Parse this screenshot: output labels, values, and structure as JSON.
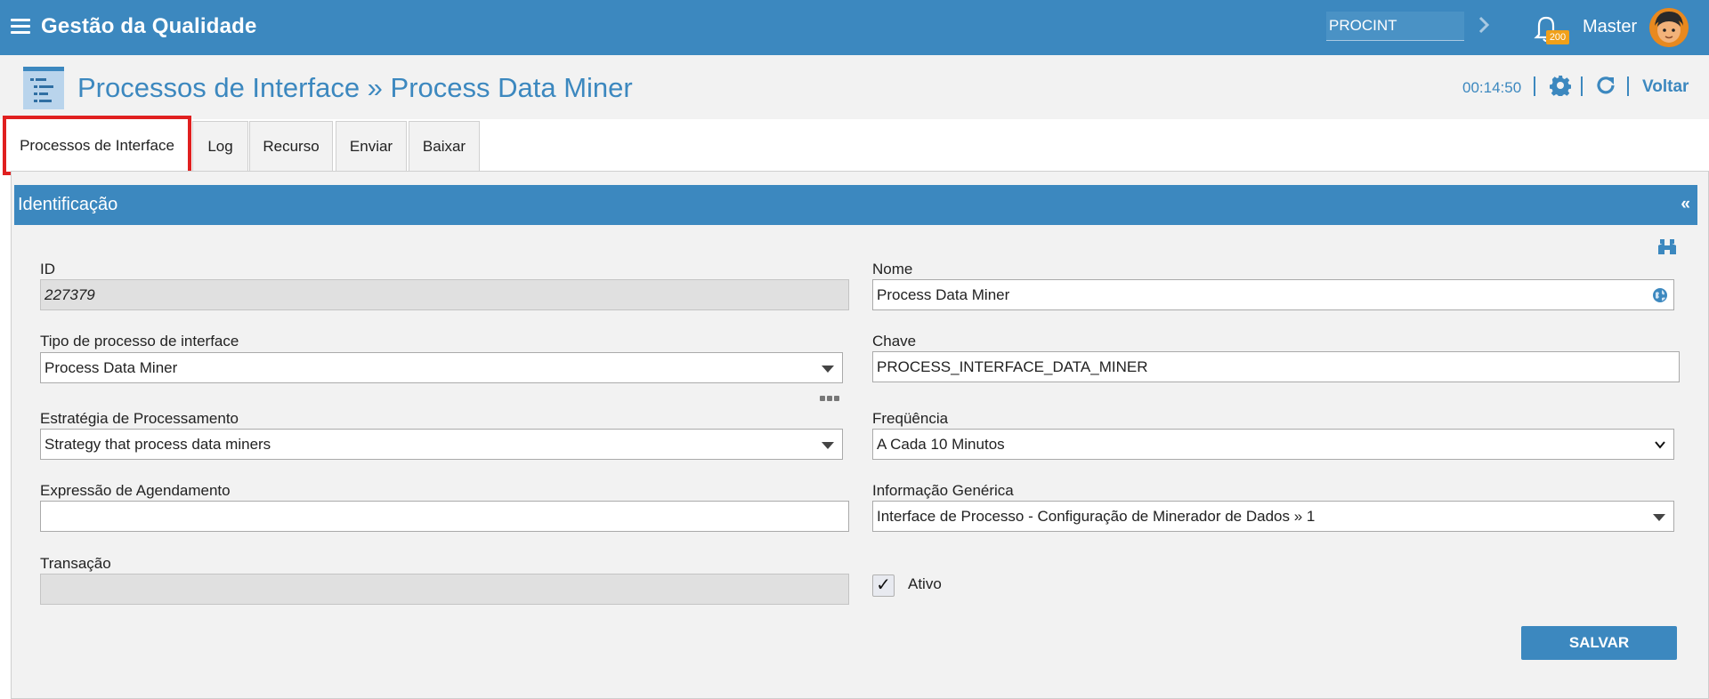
{
  "app": {
    "title": "Gestão da Qualidade"
  },
  "topbar": {
    "context_value": "PROCINT",
    "notification_count": "200",
    "user_name": "Master"
  },
  "header": {
    "title": "Processos de Interface » Process Data Miner",
    "timer": "00:14:50",
    "back_label": "Voltar"
  },
  "tabs": [
    {
      "label": "Processos de Interface",
      "active": true
    },
    {
      "label": "Log",
      "active": false
    },
    {
      "label": "Recurso",
      "active": false
    },
    {
      "label": "Enviar",
      "active": false
    },
    {
      "label": "Baixar",
      "active": false
    }
  ],
  "section": {
    "title": "Identificação",
    "collapse_glyph": "«"
  },
  "form": {
    "id": {
      "label": "ID",
      "value": "227379"
    },
    "nome": {
      "label": "Nome",
      "value": "Process Data Miner"
    },
    "tipo": {
      "label": "Tipo de processo de interface",
      "value": "Process Data Miner"
    },
    "chave": {
      "label": "Chave",
      "value": "PROCESS_INTERFACE_DATA_MINER"
    },
    "estrategia": {
      "label": "Estratégia de Processamento",
      "value": "Strategy that process data miners"
    },
    "frequencia": {
      "label": "Freqüência",
      "value": "A Cada 10 Minutos"
    },
    "expressao": {
      "label": "Expressão de Agendamento",
      "value": ""
    },
    "informacao": {
      "label": "Informação Genérica",
      "value": "Interface de Processo - Configuração de Minerador de Dados » 1"
    },
    "transacao": {
      "label": "Transação",
      "value": ""
    },
    "ativo": {
      "label": "Ativo",
      "checked": true,
      "check_glyph": "✓"
    }
  },
  "actions": {
    "save_label": "SALVAR"
  },
  "colors": {
    "primary": "#3c88bf",
    "badge": "#f0a01a",
    "active_tab_border": "#e02020"
  }
}
